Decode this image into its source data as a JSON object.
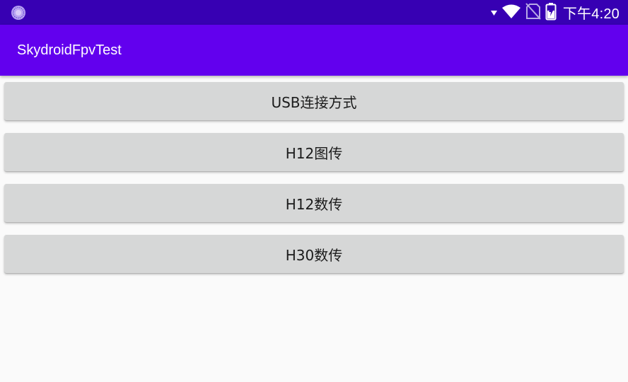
{
  "status_bar": {
    "time": "下午4:20",
    "left_icon": "loading-spinner-icon",
    "icons": [
      "signal-arrow-icon",
      "wifi-icon",
      "no-sim-icon",
      "battery-charging-icon"
    ],
    "background": "#3700b3"
  },
  "app_bar": {
    "title": "SkydroidFpvTest",
    "background": "#6200ee"
  },
  "buttons": [
    {
      "label": "USB连接方式"
    },
    {
      "label": "H12图传"
    },
    {
      "label": "H12数传"
    },
    {
      "label": "H30数传"
    }
  ],
  "colors": {
    "page_background": "#fafafa",
    "button_background": "#d6d7d7",
    "button_text": "#1b1b1b"
  }
}
